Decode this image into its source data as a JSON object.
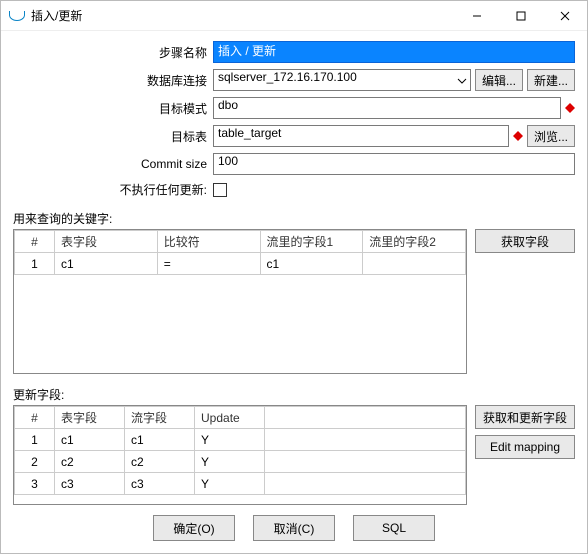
{
  "window": {
    "title": "插入/更新",
    "minimize": "–",
    "maximize": "□",
    "close": "×"
  },
  "form": {
    "step_label": "步骤名称",
    "step_value": "插入 / 更新",
    "conn_label": "数据库连接",
    "conn_value": "sqlserver_172.16.170.100",
    "edit_btn": "编辑...",
    "new_btn": "新建...",
    "schema_label": "目标模式",
    "schema_value": "dbo",
    "table_label": "目标表",
    "table_value": "table_target",
    "browse_btn": "浏览...",
    "commit_label": "Commit size",
    "commit_value": "100",
    "noupdate_label": "不执行任何更新:"
  },
  "keys": {
    "section_label": "用来查询的关键字:",
    "get_fields_btn": "获取字段",
    "headers": {
      "rownum": "#",
      "tablefield": "表字段",
      "comparator": "比较符",
      "stream1": "流里的字段1",
      "stream2": "流里的字段2"
    },
    "rows": [
      {
        "n": "1",
        "tablefield": "c1",
        "comparator": "=",
        "stream1": "c1",
        "stream2": ""
      }
    ]
  },
  "updates": {
    "section_label": "更新字段:",
    "get_update_btn": "获取和更新字段",
    "edit_mapping_btn": "Edit mapping",
    "headers": {
      "rownum": "#",
      "tablefield": "表字段",
      "streamfield": "流字段",
      "update": "Update"
    },
    "rows": [
      {
        "n": "1",
        "tablefield": "c1",
        "streamfield": "c1",
        "update": "Y"
      },
      {
        "n": "2",
        "tablefield": "c2",
        "streamfield": "c2",
        "update": "Y"
      },
      {
        "n": "3",
        "tablefield": "c3",
        "streamfield": "c3",
        "update": "Y"
      }
    ]
  },
  "footer": {
    "ok": "确定(O)",
    "cancel": "取消(C)",
    "sql": "SQL"
  }
}
